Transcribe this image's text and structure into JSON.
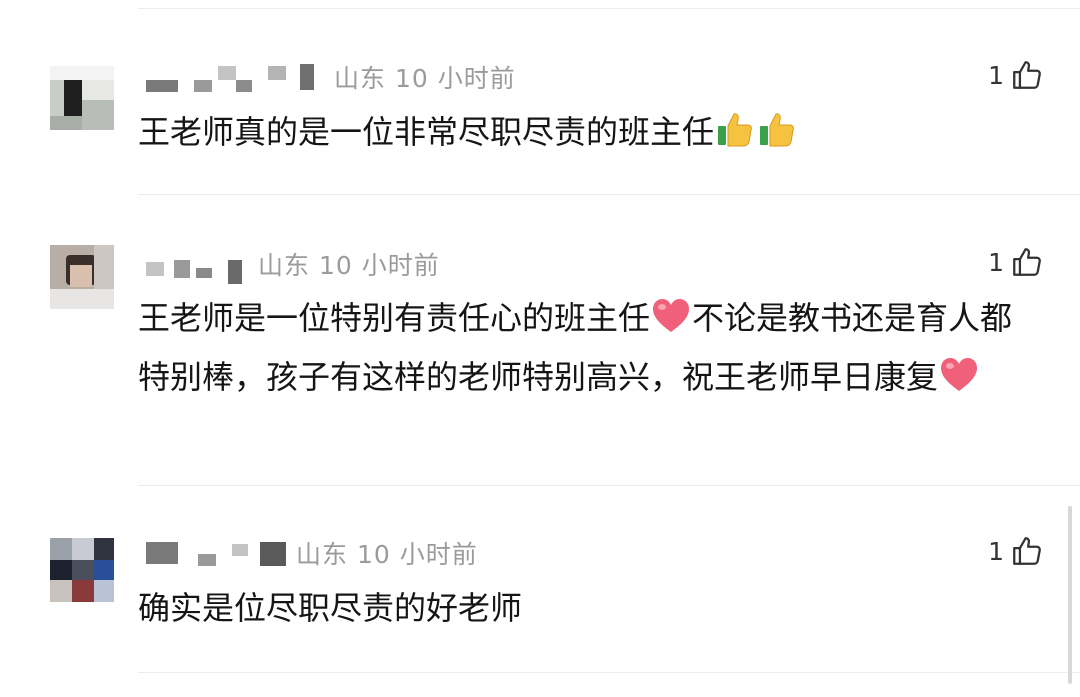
{
  "comments": [
    {
      "location": "山东",
      "time": "10 小时前",
      "like_count": "1",
      "text": "王老师真的是一位非常尽职尽责的班主任",
      "trailing_emojis": [
        "thumbs-up",
        "thumbs-up"
      ]
    },
    {
      "location": "山东",
      "time": "10 小时前",
      "like_count": "1",
      "text_part1": "王老师是一位特别有责任心的班主任",
      "text_part2": "不论是教书还是育人都特别棒，孩子有这样的老师特别高兴，祝王老师早日康复",
      "emojis": [
        "heart",
        "heart"
      ]
    },
    {
      "location": "山东",
      "time": "10 小时前",
      "like_count": "1",
      "text": "确实是位尽职尽责的好老师"
    }
  ],
  "colors": {
    "meta_text": "#9b9b9b",
    "comment_text": "#151515",
    "heart": "#f0607a",
    "thumb": "#f6c341",
    "divider": "#ececec"
  }
}
